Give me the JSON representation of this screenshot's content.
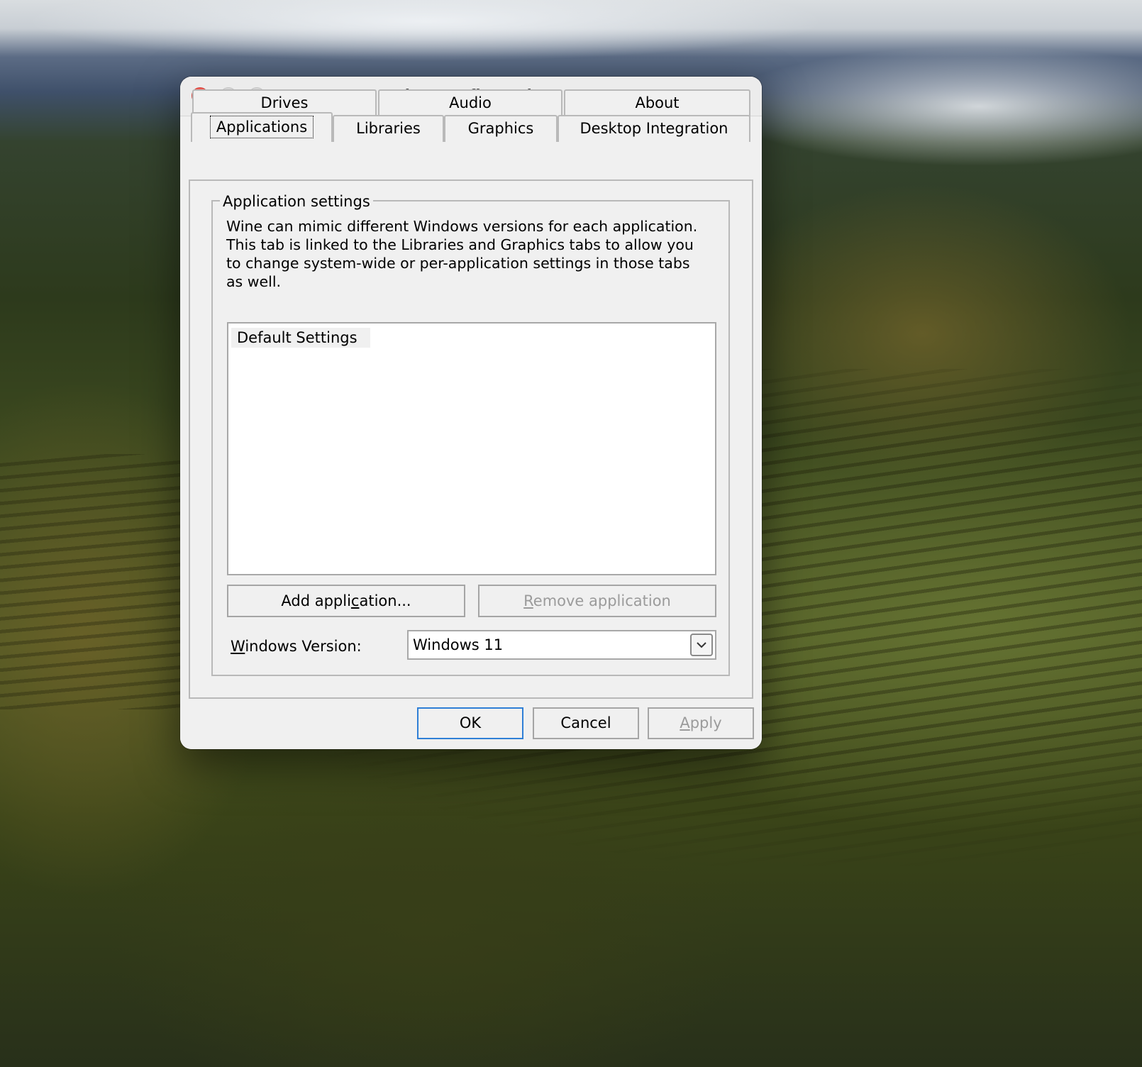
{
  "window": {
    "title": "Wine configuration"
  },
  "tabs": {
    "row1": [
      {
        "label": "Drives"
      },
      {
        "label": "Audio"
      },
      {
        "label": "About"
      }
    ],
    "row2": [
      {
        "label": "Applications",
        "selected": true
      },
      {
        "label": "Libraries"
      },
      {
        "label": "Graphics"
      },
      {
        "label": "Desktop Integration"
      }
    ]
  },
  "app_settings": {
    "group_title": "Application settings",
    "description": "Wine can mimic different Windows versions for each application. This tab is linked to the Libraries and Graphics tabs to allow you to change system-wide or per-application settings in those tabs as well.",
    "list_items": [
      "Default Settings"
    ],
    "add_button": {
      "prefix": "Add appli",
      "mnemonic": "c",
      "suffix": "ation..."
    },
    "remove_button": {
      "mnemonic": "R",
      "suffix": "emove application",
      "enabled": false
    },
    "version_label": {
      "mnemonic": "W",
      "suffix": "indows Version:"
    },
    "version_value": "Windows 11"
  },
  "footer": {
    "ok_label": "OK",
    "cancel_label": "Cancel",
    "apply_label": {
      "mnemonic": "A",
      "suffix": "pply",
      "enabled": false
    }
  },
  "colors": {
    "close": "#ee5a52",
    "inactive_traffic": "#d6d6d6",
    "dialog_bg": "#f0f0f0",
    "default_button_border": "#2f7fd6",
    "disabled_text": "#9b9b9b"
  },
  "icons": {
    "close": "close-icon",
    "minimize": "minimize-icon",
    "maximize": "maximize-icon",
    "dropdown": "chevron-down-icon"
  }
}
